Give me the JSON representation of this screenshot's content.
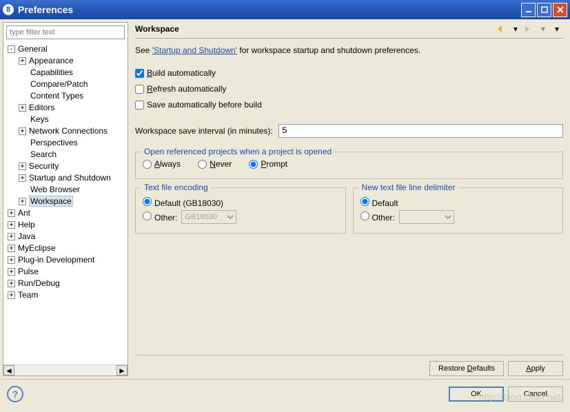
{
  "window": {
    "title": "Preferences"
  },
  "filter": {
    "placeholder": "type filter text"
  },
  "tree": [
    {
      "label": "General",
      "expander": "-",
      "depth": 0,
      "selected": false,
      "children": [
        {
          "label": "Appearance",
          "expander": "+",
          "depth": 1
        },
        {
          "label": "Capabilities",
          "expander": "",
          "depth": 1
        },
        {
          "label": "Compare/Patch",
          "expander": "",
          "depth": 1
        },
        {
          "label": "Content Types",
          "expander": "",
          "depth": 1
        },
        {
          "label": "Editors",
          "expander": "+",
          "depth": 1
        },
        {
          "label": "Keys",
          "expander": "",
          "depth": 1
        },
        {
          "label": "Network Connections",
          "expander": "+",
          "depth": 1
        },
        {
          "label": "Perspectives",
          "expander": "",
          "depth": 1
        },
        {
          "label": "Search",
          "expander": "",
          "depth": 1
        },
        {
          "label": "Security",
          "expander": "+",
          "depth": 1
        },
        {
          "label": "Startup and Shutdown",
          "expander": "+",
          "depth": 1
        },
        {
          "label": "Web Browser",
          "expander": "",
          "depth": 1
        },
        {
          "label": "Workspace",
          "expander": "+",
          "depth": 1,
          "selected": true
        }
      ]
    },
    {
      "label": "Ant",
      "expander": "+",
      "depth": 0
    },
    {
      "label": "Help",
      "expander": "+",
      "depth": 0
    },
    {
      "label": "Java",
      "expander": "+",
      "depth": 0
    },
    {
      "label": "MyEclipse",
      "expander": "+",
      "depth": 0
    },
    {
      "label": "Plug-in Development",
      "expander": "+",
      "depth": 0
    },
    {
      "label": "Pulse",
      "expander": "+",
      "depth": 0
    },
    {
      "label": "Run/Debug",
      "expander": "+",
      "depth": 0
    },
    {
      "label": "Team",
      "expander": "+",
      "depth": 0
    }
  ],
  "page": {
    "title": "Workspace",
    "desc_prefix": "See ",
    "desc_link": "'Startup and Shutdown'",
    "desc_suffix": " for workspace startup and shutdown preferences.",
    "build_label": "Build automatically",
    "build_mn": "B",
    "refresh_label": "Refresh automatically",
    "refresh_mn": "R",
    "save_label": "Save automatically before build",
    "interval_label": "Workspace save interval (in minutes):",
    "interval_value": "5",
    "open_ref_legend": "Open referenced projects when a project is opened",
    "open_ref": {
      "always": "Always",
      "never": "Never",
      "prompt": "Prompt"
    },
    "encoding": {
      "legend": "Text file encoding",
      "default_label": "Default (GB18030)",
      "other_label": "Other:",
      "other_value": "GB18030"
    },
    "delimiter": {
      "legend": "New text file line delimiter",
      "default_label": "Default",
      "other_label": "Other:"
    },
    "restore": "Restore Defaults",
    "apply": "Apply"
  },
  "buttons": {
    "ok": "OK",
    "cancel": "Cancel"
  },
  "watermark": "http://blog.csdn.net/"
}
